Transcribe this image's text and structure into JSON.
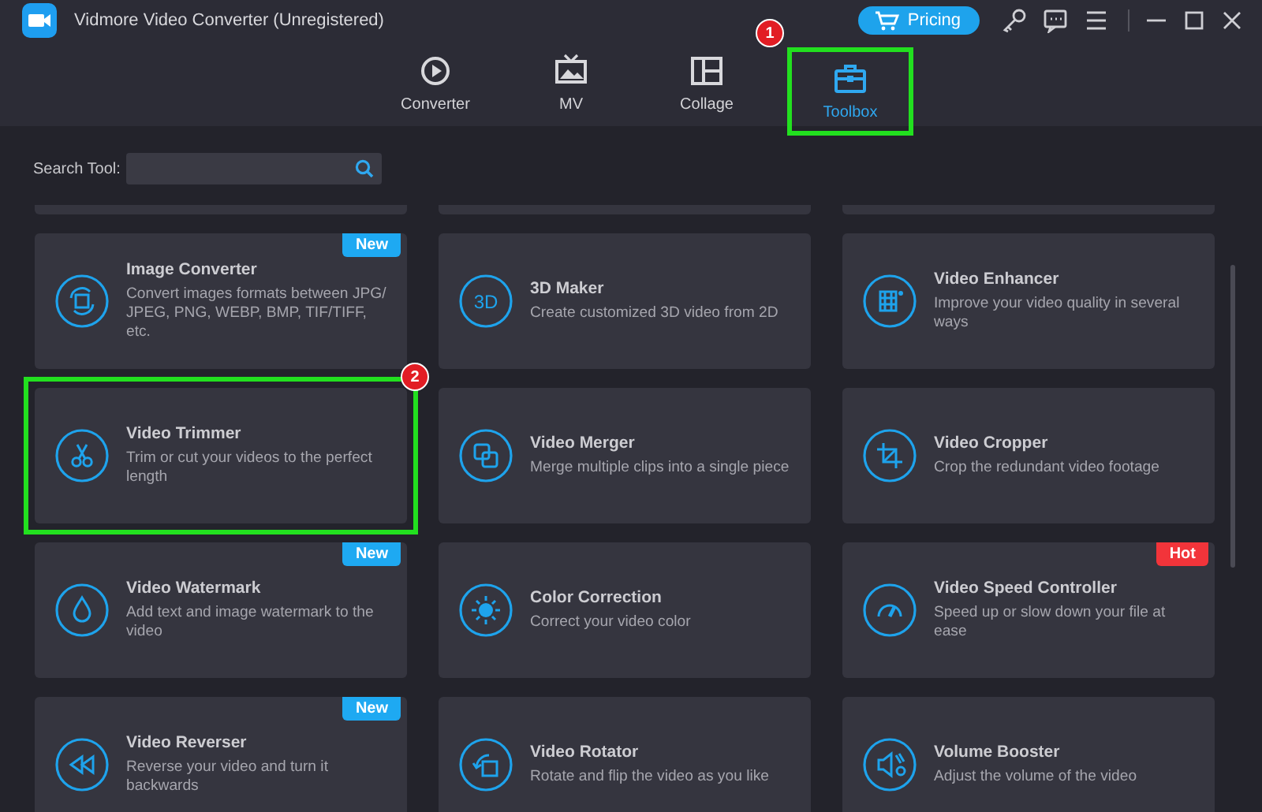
{
  "window": {
    "title": "Vidmore Video Converter (Unregistered)"
  },
  "pricing_button": "Pricing",
  "tabs": [
    {
      "label": "Converter",
      "selected": false
    },
    {
      "label": "MV",
      "selected": false
    },
    {
      "label": "Collage",
      "selected": false
    },
    {
      "label": "Toolbox",
      "selected": true,
      "callout": "1"
    }
  ],
  "search": {
    "label": "Search Tool:"
  },
  "tools": [
    {
      "title": "Image Converter",
      "description": "Convert images formats between JPG/ JPEG, PNG, WEBP, BMP, TIF/TIFF, etc.",
      "badge": {
        "text": "New",
        "color": "#1ea9f2"
      }
    },
    {
      "title": "3D Maker",
      "description": "Create customized 3D video from 2D",
      "icon_text": "3D"
    },
    {
      "title": "Video Enhancer",
      "description": "Improve your video quality in several ways"
    },
    {
      "title": "Video Trimmer",
      "description": "Trim or cut your videos to the perfect length",
      "callout": "2"
    },
    {
      "title": "Video Merger",
      "description": "Merge multiple clips into a single piece"
    },
    {
      "title": "Video Cropper",
      "description": "Crop the redundant video footage"
    },
    {
      "title": "Video Watermark",
      "description": "Add text and image watermark to the video",
      "badge": {
        "text": "New",
        "color": "#1ea9f2"
      }
    },
    {
      "title": "Color Correction",
      "description": "Correct your video color"
    },
    {
      "title": "Video Speed Controller",
      "description": "Speed up or slow down your file at ease",
      "badge": {
        "text": "Hot",
        "color": "#f2343a"
      }
    },
    {
      "title": "Video Reverser",
      "description": "Reverse your video and turn it backwards",
      "badge": {
        "text": "New",
        "color": "#1ea9f2"
      }
    },
    {
      "title": "Video Rotator",
      "description": "Rotate and flip the video as you like"
    },
    {
      "title": "Volume Booster",
      "description": "Adjust the volume of the video"
    }
  ]
}
